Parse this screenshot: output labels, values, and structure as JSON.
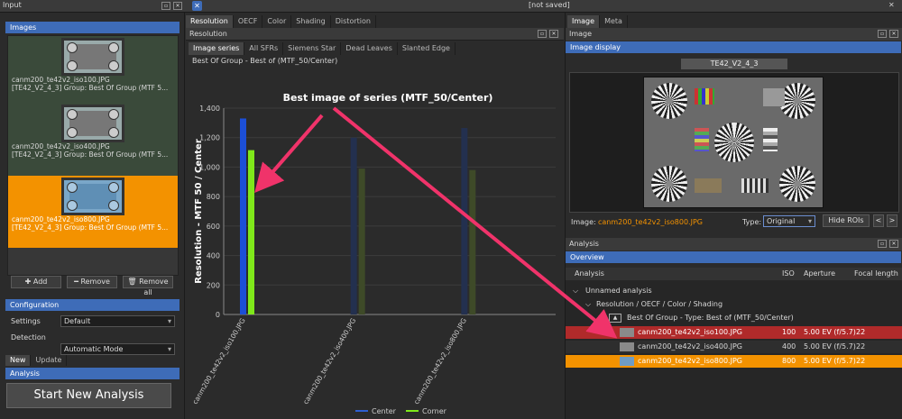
{
  "app": {
    "status": "[not saved]"
  },
  "input_panel": {
    "title": "Input",
    "images_header": "Images",
    "images": [
      {
        "name": "canm200_te42v2_iso100.JPG",
        "group": "[TE42_V2_4_3] Group: Best Of Group (MTF 5..."
      },
      {
        "name": "canm200_te42v2_iso400.JPG",
        "group": "[TE42_V2_4_3] Group: Best Of Group (MTF 5..."
      },
      {
        "name": "canm200_te42v2_iso800.JPG",
        "group": "[TE42_V2_4_3] Group: Best Of Group (MTF 5..."
      }
    ],
    "add_label": "Add",
    "remove_label": "Remove",
    "remove_all_label": "Remove all",
    "config_header": "Configuration",
    "settings_label": "Settings",
    "settings_value": "Default",
    "detection_label": "Detection",
    "detection_value": "Automatic Mode",
    "tab_new": "New",
    "tab_update": "Update",
    "analysis_header": "Analysis",
    "start_label": "Start New Analysis"
  },
  "center": {
    "tabs": [
      "Resolution",
      "OECF",
      "Color",
      "Shading",
      "Distortion"
    ],
    "subtitle": "Resolution",
    "subtabs": [
      "Image series",
      "All SFRs",
      "Siemens Star",
      "Dead Leaves",
      "Slanted Edge"
    ],
    "caption": "Best Of Group - Best of (MTF_50/Center)"
  },
  "chart_data": {
    "type": "bar",
    "title": "Best image of series (MTF_50/Center)",
    "ylabel": "Resolution - MTF 50 / Center",
    "xlabel": "",
    "categories": [
      "canm200_te42v2_iso100.JPG",
      "canm200_te42v2_iso400.JPG",
      "canm200_te42v2_iso800.JPG"
    ],
    "series": [
      {
        "name": "Center",
        "values": [
          1330,
          1200,
          1265
        ],
        "color": "#1c4fd6",
        "faded_color": "#23304f"
      },
      {
        "name": "Corner",
        "values": [
          1115,
          990,
          980
        ],
        "color": "#7fe81a",
        "faded_color": "#3e4a28"
      }
    ],
    "highlight_index": 0,
    "ylim": [
      0,
      1400
    ],
    "yticks": [
      "0",
      "200",
      "400",
      "600",
      "800",
      "1,000",
      "1,200",
      "1,400"
    ],
    "grid": true,
    "legend": "bottom"
  },
  "right": {
    "tabs": [
      "Image",
      "Meta"
    ],
    "image_panel_title": "Image",
    "image_display_header": "Image display",
    "image_name": "TE42_V2_4_3",
    "image_label": "Image:",
    "image_file": "canm200_te42v2_iso800.JPG",
    "type_label": "Type:",
    "type_value": "Original",
    "hide_rois": "Hide ROIs",
    "prev": "<",
    "next": ">",
    "analysis_title": "Analysis",
    "overview": "Overview",
    "cols": [
      "Analysis",
      "ISO",
      "Aperture",
      "Focal length"
    ],
    "tree": {
      "root": "Unnamed analysis",
      "child": "Resolution / OECF / Color / Shading",
      "group": "Best Of Group - Type: Best of (MTF_50/Center)"
    },
    "rows": [
      {
        "name": "canm200_te42v2_iso100.JPG",
        "iso": "100",
        "aperture": "5.00 EV (f/5.7)",
        "focal": "22",
        "state": "red"
      },
      {
        "name": "canm200_te42v2_iso400.JPG",
        "iso": "400",
        "aperture": "5.00 EV (f/5.7)",
        "focal": "22",
        "state": "normal"
      },
      {
        "name": "canm200_te42v2_iso800.JPG",
        "iso": "800",
        "aperture": "5.00 EV (f/5.7)",
        "focal": "22",
        "state": "orange"
      }
    ]
  },
  "colors": {
    "accent_blue": "#3e6cb8",
    "selected_orange": "#f39200",
    "highlight_red": "#b02a2a",
    "annotation_arrow": "#f0336a"
  }
}
